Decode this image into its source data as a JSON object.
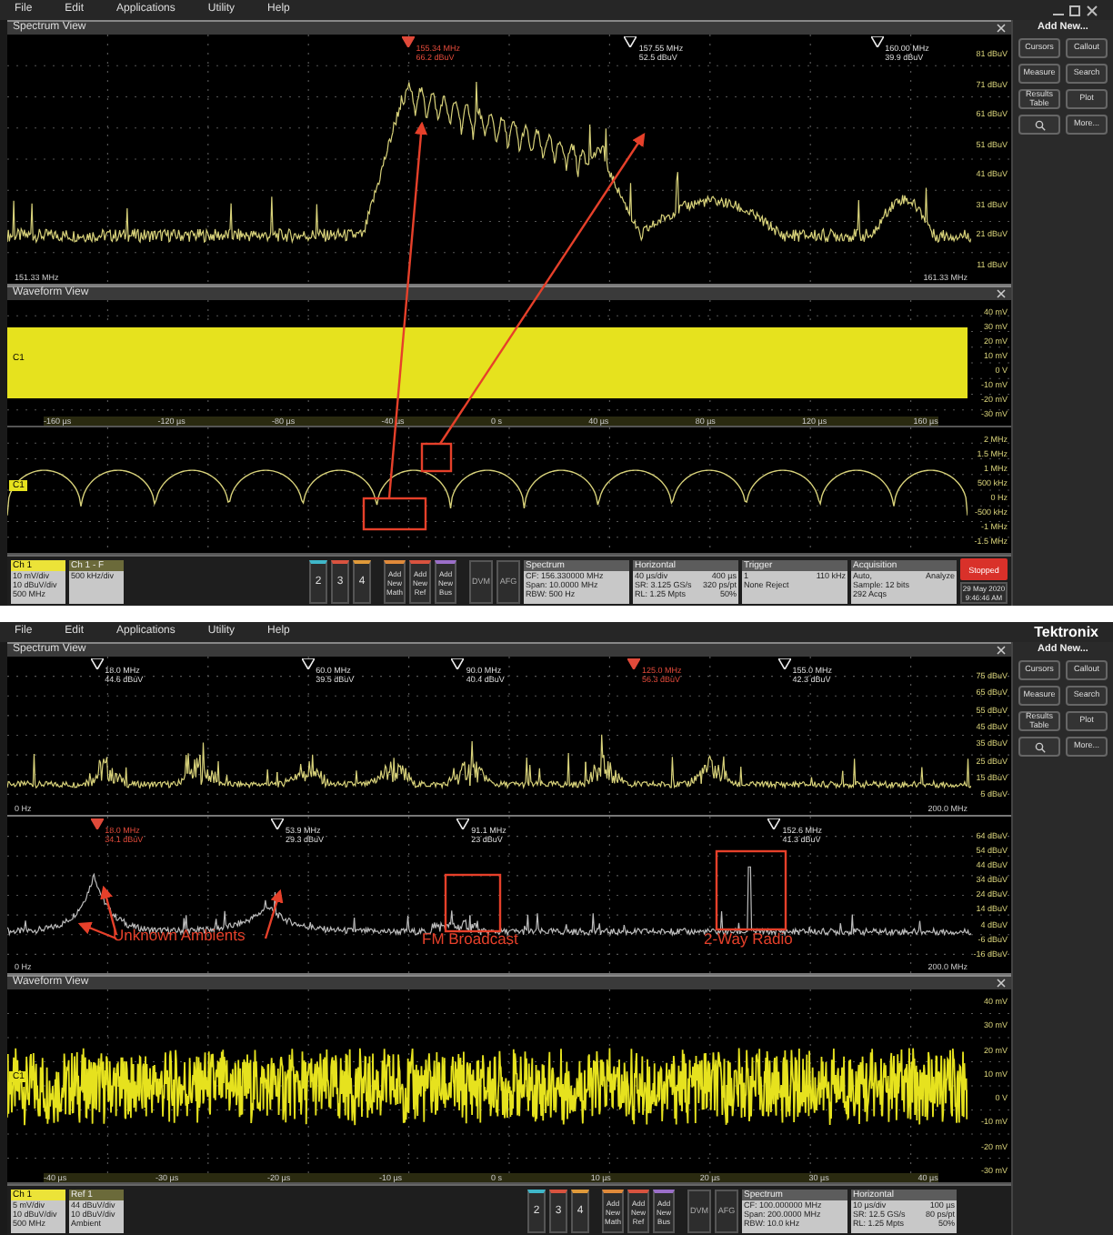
{
  "screens": [
    {
      "menu": [
        "File",
        "Edit",
        "Applications",
        "Utility",
        "Help"
      ],
      "window_controls": true,
      "spectrum": {
        "title": "Spectrum View",
        "traces": [
          {
            "color": "#d8d27a",
            "x_start": "151.33 MHz",
            "x_end": "161.33 MHz",
            "y_labels": [
              "81 dBuV",
              "71 dBuV",
              "61 dBuV",
              "51 dBuV",
              "41 dBuV",
              "31 dBuV",
              "21 dBuV",
              "11 dBuV"
            ],
            "markers": [
              {
                "freq": "155.34 MHz",
                "amp": "66.2 dBuV",
                "reference": true
              },
              {
                "freq": "157.55 MHz",
                "amp": "52.5 dBuV",
                "reference": false
              },
              {
                "freq": "160.00 MHz",
                "amp": "39.9 dBuV",
                "reference": false
              }
            ]
          }
        ]
      },
      "waveform": {
        "title": "Waveform View",
        "channels": [
          {
            "tag": "C1",
            "kind": "band",
            "y_labels": [
              "40 mV",
              "30 mV",
              "20 mV",
              "10 mV",
              "0 V",
              "-10 mV",
              "-20 mV",
              "-30 mV"
            ],
            "x_labels": [
              "-160 µs",
              "-120 µs",
              "-80 µs",
              "-40 µs",
              "0 s",
              "40 µs",
              "80 µs",
              "120 µs",
              "160 µs"
            ]
          },
          {
            "tag": "C1",
            "kind": "pulses",
            "y_labels": [
              "2 MHz",
              "1.5 MHz",
              "1 MHz",
              "500 kHz",
              "0 Hz",
              "-500 kHz",
              "-1 MHz",
              "-1.5 MHz"
            ]
          }
        ]
      },
      "status": {
        "channels": [
          {
            "title": "Ch 1",
            "selected": true,
            "lines": [
              "10 mV/div",
              "10 dBuV/div",
              "500 MHz"
            ]
          },
          {
            "title": "Ch 1 - F",
            "selected": false,
            "lines": [
              "500 kHz/div"
            ]
          }
        ],
        "buttons": [
          {
            "label": "2",
            "color": "#3fb7c9"
          },
          {
            "label": "3",
            "color": "#d9533f"
          },
          {
            "label": "4",
            "color": "#e09a3a"
          }
        ],
        "add_buttons": [
          {
            "label": "Add New Math",
            "color": "#e08a3a"
          },
          {
            "label": "Add New Ref",
            "color": "#d9533f"
          },
          {
            "label": "Add New Bus",
            "color": "#9b6fc9"
          }
        ],
        "tools": [
          "DVM",
          "AFG"
        ],
        "panels": [
          {
            "title": "Spectrum",
            "rows": [
              [
                "CF: 156.330000 MHz"
              ],
              [
                "Span: 10.0000 MHz"
              ],
              [
                "RBW: 500 Hz"
              ]
            ]
          },
          {
            "title": "Horizontal",
            "rows": [
              [
                "40 µs/div",
                "400 µs"
              ],
              [
                "SR: 3.125 GS/s",
                "320 ps/pt"
              ],
              [
                "RL: 1.25 Mpts",
                "50%"
              ]
            ]
          },
          {
            "title": "Trigger",
            "rows": [
              [
                "1",
                "110 kHz"
              ],
              [
                "None Reject"
              ]
            ]
          },
          {
            "title": "Acquisition",
            "rows": [
              [
                "Auto,",
                "Analyze"
              ],
              [
                "Sample: 12 bits"
              ],
              [
                "292 Acqs"
              ]
            ]
          }
        ],
        "run_state": "Stopped",
        "date": "29 May 2020",
        "time": "9:46:46 AM"
      },
      "side": {
        "title": "Add New...",
        "buttons": [
          "Cursors",
          "Callout",
          "Measure",
          "Search",
          "Results Table",
          "Plot"
        ],
        "more": "More..."
      }
    },
    {
      "menu": [
        "File",
        "Edit",
        "Applications",
        "Utility",
        "Help"
      ],
      "window_controls": false,
      "brand": "Tektronix",
      "spectrum": {
        "title": "Spectrum View",
        "traces": [
          {
            "color": "#d8d27a",
            "x_start": "0 Hz",
            "x_end": "200.0 MHz",
            "y_labels": [
              "75 dBuV",
              "65 dBuV",
              "55 dBuV",
              "45 dBuV",
              "35 dBuV",
              "25 dBuV",
              "15 dBuV",
              "5 dBuV"
            ],
            "markers": [
              {
                "freq": "18.0 MHz",
                "amp": "44.6 dBuV",
                "reference": false
              },
              {
                "freq": "60.0 MHz",
                "amp": "39.5 dBuV",
                "reference": false
              },
              {
                "freq": "90.0 MHz",
                "amp": "40.4 dBuV",
                "reference": false
              },
              {
                "freq": "125.0 MHz",
                "amp": "56.3 dBuV",
                "reference": true
              },
              {
                "freq": "155.0 MHz",
                "amp": "42.3 dBuV",
                "reference": false
              }
            ]
          },
          {
            "color": "#bdbdbd",
            "x_start": "0 Hz",
            "x_end": "200.0 MHz",
            "y_labels": [
              "64 dBuV",
              "54 dBuV",
              "44 dBuV",
              "34 dBuV",
              "24 dBuV",
              "14 dBuV",
              "4 dBuV",
              "-6 dBuV",
              "-16 dBuV"
            ],
            "markers": [
              {
                "freq": "18.0 MHz",
                "amp": "34.1 dBuV",
                "reference": true
              },
              {
                "freq": "53.9 MHz",
                "amp": "29.3 dBuV",
                "reference": false
              },
              {
                "freq": "91.1 MHz",
                "amp": "23 dBuV",
                "reference": false
              },
              {
                "freq": "152.6 MHz",
                "amp": "41.3 dBuV",
                "reference": false
              }
            ]
          }
        ]
      },
      "annotations": [
        {
          "text": "Unknown Ambients"
        },
        {
          "text": "FM Broadcast"
        },
        {
          "text": "2-Way Radio"
        }
      ],
      "waveform": {
        "title": "Waveform View",
        "channels": [
          {
            "tag": "C1",
            "kind": "noise",
            "y_labels": [
              "40 mV",
              "30 mV",
              "20 mV",
              "10 mV",
              "0 V",
              "-10 mV",
              "-20 mV",
              "-30 mV"
            ],
            "x_labels": [
              "-40 µs",
              "-30 µs",
              "-20 µs",
              "-10 µs",
              "0 s",
              "10 µs",
              "20 µs",
              "30 µs",
              "40 µs"
            ]
          }
        ]
      },
      "status": {
        "channels": [
          {
            "title": "Ch 1",
            "selected": true,
            "lines": [
              "5 mV/div",
              "10 dBuV/div",
              "500 MHz"
            ]
          },
          {
            "title": "Ref 1",
            "selected": false,
            "lines": [
              "44 dBuV/div",
              "10 dBuV/div",
              "Ambient"
            ]
          }
        ],
        "buttons": [
          {
            "label": "2",
            "color": "#3fb7c9"
          },
          {
            "label": "3",
            "color": "#d9533f"
          },
          {
            "label": "4",
            "color": "#e09a3a"
          }
        ],
        "add_buttons": [
          {
            "label": "Add New Math",
            "color": "#e08a3a"
          },
          {
            "label": "Add New Ref",
            "color": "#d9533f"
          },
          {
            "label": "Add New Bus",
            "color": "#9b6fc9"
          }
        ],
        "tools": [
          "DVM",
          "AFG"
        ],
        "panels": [
          {
            "title": "Spectrum",
            "rows": [
              [
                "CF: 100.000000 MHz"
              ],
              [
                "Span: 200.0000 MHz"
              ],
              [
                "RBW: 10.0 kHz"
              ]
            ]
          },
          {
            "title": "Horizontal",
            "rows": [
              [
                "10 µs/div",
                "100 µs"
              ],
              [
                "SR: 12.5 GS/s",
                "80 ps/pt"
              ],
              [
                "RL: 1.25 Mpts",
                "50%"
              ]
            ]
          }
        ]
      },
      "side": {
        "title": "Add New...",
        "buttons": [
          "Cursors",
          "Callout",
          "Measure",
          "Search",
          "Results Table",
          "Plot"
        ],
        "more": "More..."
      }
    }
  ]
}
